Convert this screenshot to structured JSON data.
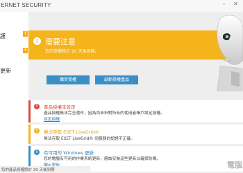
{
  "window": {
    "title": "ERNET SECURITY",
    "minimize_glyph": "–",
    "close_glyph": "✕"
  },
  "sidebar": {
    "items": [
      {
        "label": "護",
        "badge": "!"
      },
      {
        "label": "",
        "badge": "+"
      },
      {
        "label": "",
        "badge": ""
      },
      {
        "label": "更新",
        "badge": ""
      }
    ]
  },
  "alert": {
    "icon": "!",
    "title": "需要注意",
    "subtitle": "您的授權將於 20 天後到期。",
    "primary_button": "購買授權",
    "secondary_button": "啟動授權產品"
  },
  "notifications": [
    {
      "title": "產品授權未設定",
      "body": "產品授權無法完全運作，因為尚未針對所有的使用者帳戶設定授權。",
      "link": "設定授權",
      "accent": "#d94a3a",
      "icon": "!"
    },
    {
      "title": "無法存取 ESET LiveGrid®",
      "body": "無法存取 ESET LiveGrid® 伺服器的認證不正確。",
      "link": "",
      "accent": "#f5b41c",
      "icon": "!"
    },
    {
      "title": "有可用的 Windows 更新",
      "body": "您的電腦有可用的作業系統更新，應該安裝這些更新以確保防護。",
      "link": "顯示更新",
      "accent": "#3a8fc4",
      "icon": "i"
    }
  ],
  "footer": {
    "text": "您的產品授權將於 20 天後到期"
  },
  "watermark": "電腦王"
}
